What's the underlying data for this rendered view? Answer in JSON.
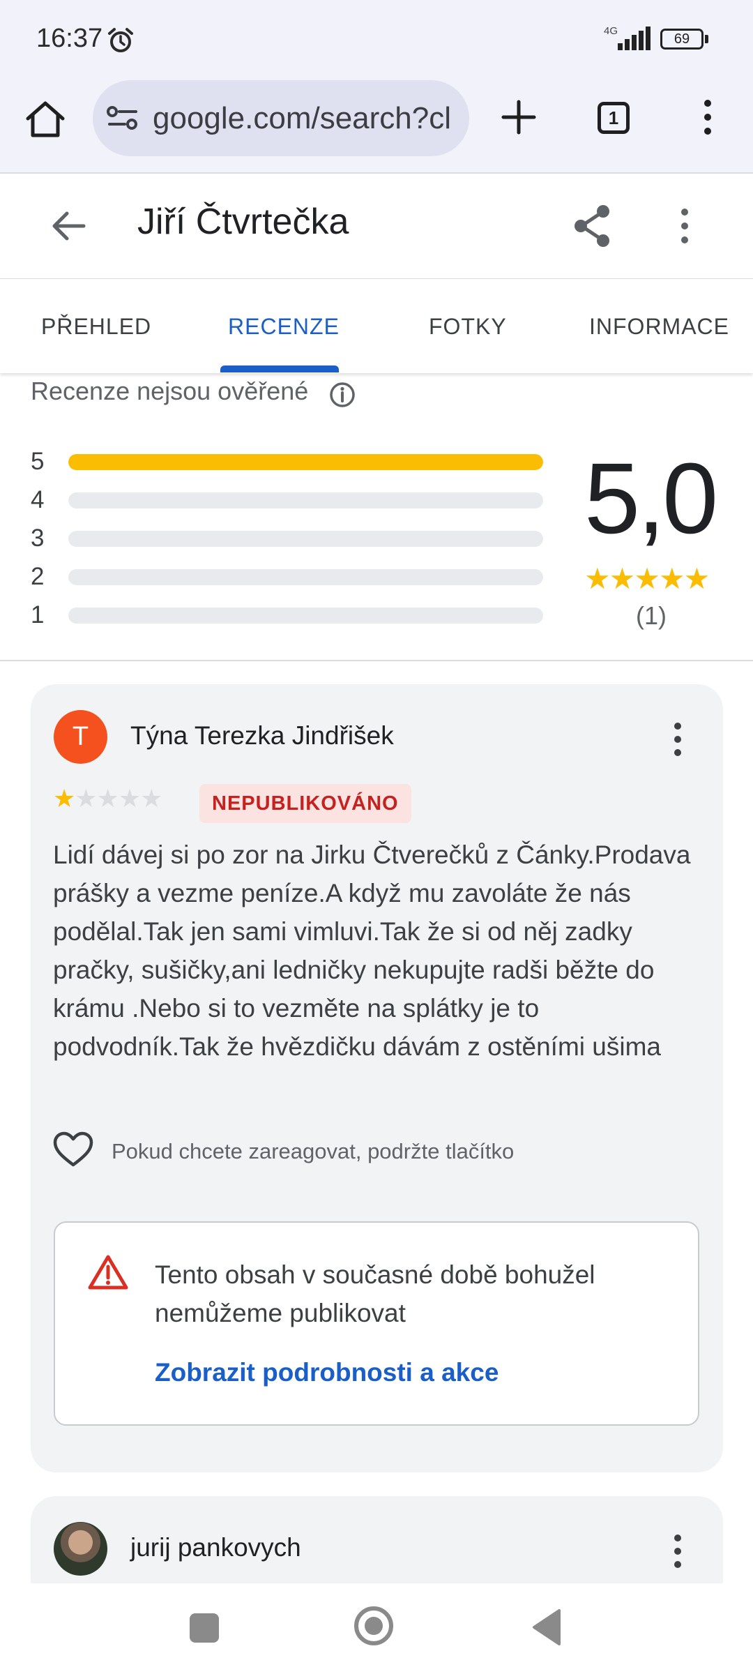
{
  "status_bar": {
    "time": "16:37",
    "network": "4G",
    "battery": "69"
  },
  "browser": {
    "url": "google.com/search?cl",
    "tab_count": "1"
  },
  "header": {
    "title": "Jiří Čtvrtečka"
  },
  "tabs": [
    {
      "label": "PŘEHLED"
    },
    {
      "label": "RECENZE"
    },
    {
      "label": "FOTKY"
    },
    {
      "label": "INFORMACE"
    }
  ],
  "active_tab": "RECENZE",
  "rating": {
    "unverified_note": "Recenze nejsou ověřené",
    "average": "5,0",
    "stars": "★★★★★",
    "count": "(1)",
    "distribution": [
      {
        "label": "5",
        "fraction": 1.0
      },
      {
        "label": "4",
        "fraction": 0
      },
      {
        "label": "3",
        "fraction": 0
      },
      {
        "label": "2",
        "fraction": 0
      },
      {
        "label": "1",
        "fraction": 0
      }
    ]
  },
  "reviews": [
    {
      "avatar_letter": "T",
      "name": "Týna Terezka Jindřišek",
      "stars_on": "★",
      "stars_off": "★★★★",
      "rating": 1,
      "badge": "NEPUBLIKOVÁNO",
      "text": "Lidí dávej si po zor na Jirku Čtverečků z Čánky.Prodava prášky a vezme peníze.A když mu zavoláte že nás podělal.Tak jen sami vimluvi.Tak že si od něj zadky pračky, sušičky,ani ledničky nekupujte radši běžte do krámu .Nebo si to vezměte na splátky je to podvodník.Tak že hvězdičku dávám z ostěními ušima",
      "react_hint": "Pokud chcete zareagovat, podržte tlačítko",
      "notice_text": "Tento obsah v současné době bohužel nemůžeme publikovat",
      "notice_link": "Zobrazit podrobnosti a akce"
    },
    {
      "name": "jurij pankovych"
    }
  ],
  "colors": {
    "accent": "#1a5fc7",
    "star": "#fbbc04",
    "badge_bg": "#fbe3e1",
    "badge_text": "#c5221f",
    "avatar": "#f4511e"
  }
}
